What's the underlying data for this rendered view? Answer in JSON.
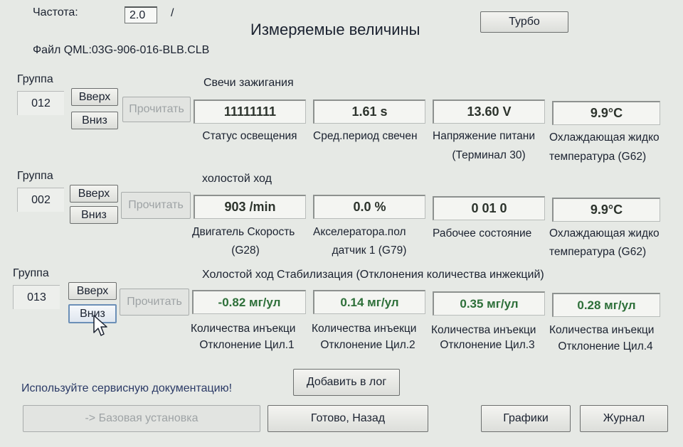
{
  "header": {
    "freq_label": "Частота:",
    "freq_value": "2.0",
    "freq_slash": "/",
    "title": "Измеряемые величины",
    "turbo_label": "Турбо",
    "file_label": "Файл QML:03G-906-016-BLB.CLB"
  },
  "groups": [
    {
      "label": "Группа",
      "number": "012",
      "up_label": "Вверх",
      "down_label": "Вниз",
      "read_label": "Прочитать",
      "title": "Свечи зажигания",
      "values": [
        {
          "value": "11111111",
          "color": "#2c332c",
          "desc1": "Статус освещения",
          "desc2": ""
        },
        {
          "value": "1.61 s",
          "color": "#2c332c",
          "desc1": "Сред.период свечен",
          "desc2": ""
        },
        {
          "value": "13.60 V",
          "color": "#2c332c",
          "desc1": "Напряжение питани",
          "desc2": "(Терминал 30)"
        },
        {
          "value": "9.9°C",
          "color": "#2c332c",
          "desc1": "Охлаждающая жидко",
          "desc2": "температура (G62)"
        }
      ]
    },
    {
      "label": "Группа",
      "number": "002",
      "up_label": "Вверх",
      "down_label": "Вниз",
      "read_label": "Прочитать",
      "title": "холостой ход",
      "values": [
        {
          "value": "903 /min",
          "color": "#2c332c",
          "desc1": "Двигатель Скорость",
          "desc2": "(G28)"
        },
        {
          "value": "0.0 %",
          "color": "#2c332c",
          "desc1": "Акселератора.пол",
          "desc2": "датчик 1 (G79)"
        },
        {
          "value": "0 01  0",
          "color": "#2c332c",
          "desc1": "Рабочее состояние",
          "desc2": ""
        },
        {
          "value": "9.9°C",
          "color": "#2c332c",
          "desc1": "Охлаждающая жидко",
          "desc2": "температура (G62)"
        }
      ]
    },
    {
      "label": "Группа",
      "number": "013",
      "up_label": "Вверх",
      "down_label": "Вниз",
      "read_label": "Прочитать",
      "title": "Холостой ход Стабилизация (Отклонения количества инжекций)",
      "values": [
        {
          "value": "-0.82 мг/ул",
          "color": "#2d6f39",
          "desc1": "Количества инъекци",
          "desc2": "Отклонение Цил.1"
        },
        {
          "value": "0.14 мг/ул",
          "color": "#2d6f39",
          "desc1": "Количества инъекци",
          "desc2": "Отклонение Цил.2"
        },
        {
          "value": "0.35 мг/ул",
          "color": "#2d6f39",
          "desc1": "Количества инъекци",
          "desc2": "Отклонение Цил.3"
        },
        {
          "value": "0.28 мг/ул",
          "color": "#2d6f39",
          "desc1": "Количества инъекци",
          "desc2": "Отклонение Цил.4"
        }
      ]
    }
  ],
  "footer": {
    "hint": "Используйте сервисную документацию!",
    "add_log_label": "Добавить в лог",
    "basic_setting_label": "-> Базовая установка",
    "done_back_label": "Готово, Назад",
    "graphs_label": "Графики",
    "journal_label": "Журнал"
  }
}
